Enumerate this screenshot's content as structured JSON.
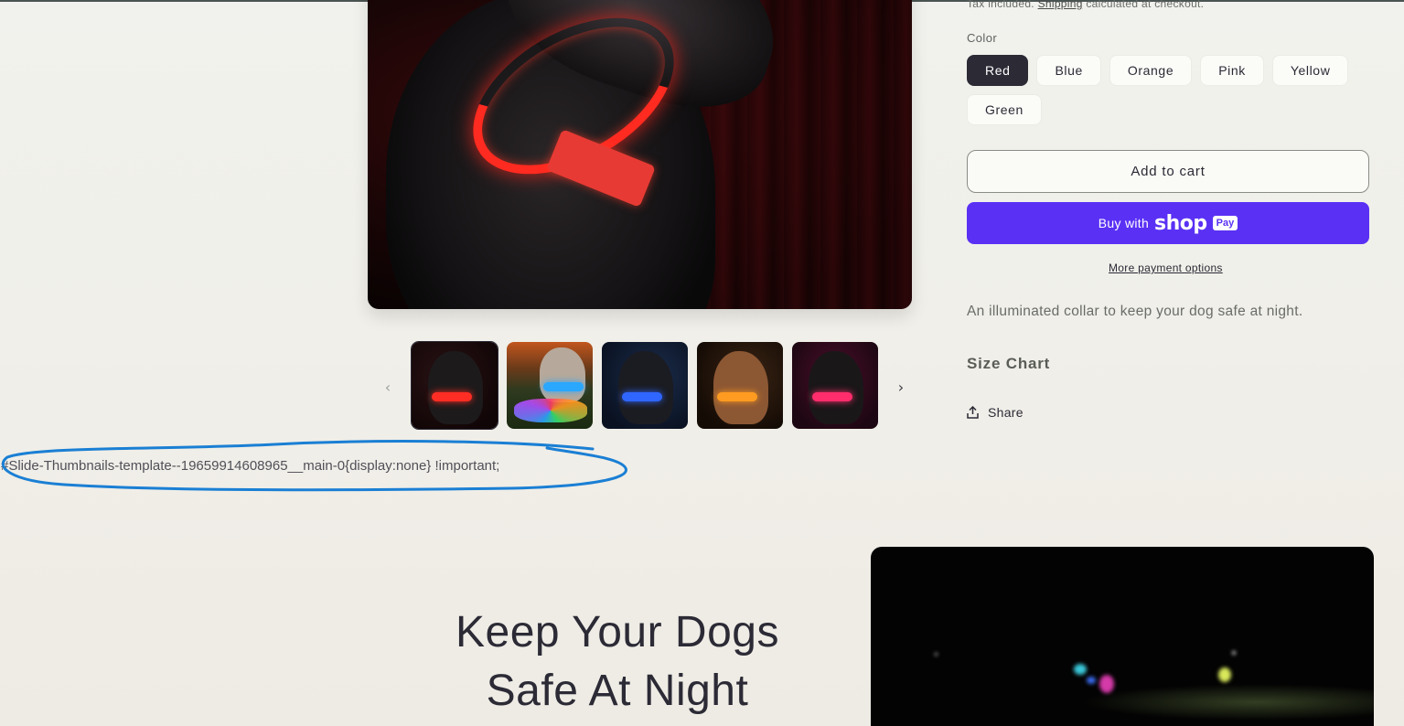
{
  "product": {
    "tax_text": "Tax included.",
    "shipping_link": "Shipping",
    "tax_suffix": "calculated at checkout.",
    "color_label": "Color",
    "colors": [
      "Red",
      "Blue",
      "Orange",
      "Pink",
      "Yellow",
      "Green"
    ],
    "selected_color": "Red",
    "add_to_cart": "Add to cart",
    "buy_with": "Buy with",
    "shop_logo": "shop",
    "pay_badge": "Pay",
    "more_payment": "More payment options",
    "description": "An illuminated collar to keep your dog safe at night.",
    "size_chart": "Size Chart",
    "share": "Share"
  },
  "gallery": {
    "prev_icon": "‹",
    "next_icon": "›",
    "thumbnail_count": 5,
    "selected_thumbnail": 1
  },
  "annotation": {
    "css_text": "#Slide-Thumbnails-template--19659914608965__main-0{display:none} !important;",
    "circle_color": "#1a7fd4"
  },
  "feature": {
    "heading_line1": "Keep Your Dogs",
    "heading_line2": "Safe At Night"
  },
  "colors": {
    "accent_shop": "#5a31f4",
    "text_dark": "#2b2a35",
    "background": "#f0efe9"
  }
}
